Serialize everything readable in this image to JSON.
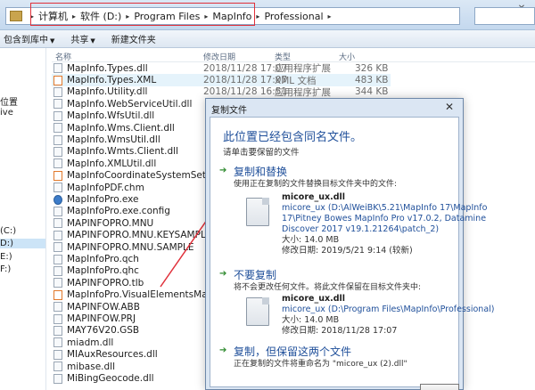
{
  "address_bar": {
    "crumbs": [
      "计算机",
      "软件 (D:)",
      "Program Files",
      "MapInfo",
      "Professional"
    ]
  },
  "window_controls": {
    "minimize": "—",
    "close": "✕"
  },
  "toolbar": {
    "items": [
      "包含到库中",
      "共享",
      "新建文件夹"
    ]
  },
  "nav": {
    "items": [
      "位置",
      "ive",
      "(C:)",
      "D:)",
      "E:)",
      "F:)"
    ]
  },
  "columns": {
    "name": "名称",
    "date": "修改日期",
    "type": "类型",
    "size": "大小"
  },
  "files": [
    {
      "name": "MapInfo.Types.dll",
      "date": "2018/11/28 17:07",
      "type": "应用程序扩展",
      "size": "326 KB",
      "icon": "dll"
    },
    {
      "name": "MapInfo.Types.XML",
      "date": "2018/11/28 17:07",
      "type": "XML 文档",
      "size": "483 KB",
      "icon": "xml"
    },
    {
      "name": "MapInfo.Utility.dll",
      "date": "2018/11/28 16:51",
      "type": "应用程序扩展",
      "size": "344 KB",
      "icon": "dll"
    },
    {
      "name": "MapInfo.WebServiceUtil.dll",
      "date": "",
      "type": "",
      "size": "",
      "icon": "dll"
    },
    {
      "name": "MapInfo.WfsUtil.dll",
      "date": "",
      "type": "",
      "size": "",
      "icon": "dll"
    },
    {
      "name": "MapInfo.Wms.Client.dll",
      "date": "",
      "type": "",
      "size": "",
      "icon": "dll"
    },
    {
      "name": "MapInfo.WmsUtil.dll",
      "date": "",
      "type": "",
      "size": "",
      "icon": "dll"
    },
    {
      "name": "MapInfo.Wmts.Client.dll",
      "date": "",
      "type": "",
      "size": "",
      "icon": "dll"
    },
    {
      "name": "MapInfo.XMLUtil.dll",
      "date": "",
      "type": "",
      "size": "",
      "icon": "dll"
    },
    {
      "name": "MapInfoCoordinateSystemSet.xml",
      "date": "",
      "type": "",
      "size": "",
      "icon": "xml"
    },
    {
      "name": "MapInfoPDF.chm",
      "date": "",
      "type": "",
      "size": "",
      "icon": "dll"
    },
    {
      "name": "MapInfoPro.exe",
      "date": "",
      "type": "",
      "size": "",
      "icon": "exe"
    },
    {
      "name": "MapInfoPro.exe.config",
      "date": "",
      "type": "",
      "size": "",
      "icon": "dll"
    },
    {
      "name": "MAPINFOPRO.MNU",
      "date": "",
      "type": "",
      "size": "",
      "icon": "dll"
    },
    {
      "name": "MAPINFOPRO.MNU.KEYSAMPLE",
      "date": "",
      "type": "",
      "size": "",
      "icon": "dll"
    },
    {
      "name": "MAPINFOPRO.MNU.SAMPLE",
      "date": "",
      "type": "",
      "size": "",
      "icon": "dll"
    },
    {
      "name": "MapInfoPro.qch",
      "date": "",
      "type": "",
      "size": "",
      "icon": "dll"
    },
    {
      "name": "MapInfoPro.qhc",
      "date": "",
      "type": "",
      "size": "",
      "icon": "dll"
    },
    {
      "name": "MAPINFOPRO.tlb",
      "date": "",
      "type": "",
      "size": "",
      "icon": "dll"
    },
    {
      "name": "MapInfoPro.VisualElementsManifest...",
      "date": "",
      "type": "",
      "size": "",
      "icon": "xml"
    },
    {
      "name": "MAPINFOW.ABB",
      "date": "",
      "type": "",
      "size": "",
      "icon": "dll"
    },
    {
      "name": "MAPINFOW.PRJ",
      "date": "",
      "type": "",
      "size": "",
      "icon": "dll"
    },
    {
      "name": "MAY76V20.GSB",
      "date": "",
      "type": "",
      "size": "",
      "icon": "dll"
    },
    {
      "name": "miadm.dll",
      "date": "",
      "type": "",
      "size": "",
      "icon": "dll"
    },
    {
      "name": "MIAuxResources.dll",
      "date": "",
      "type": "",
      "size": "",
      "icon": "dll"
    },
    {
      "name": "mibase.dll",
      "date": "",
      "type": "",
      "size": "",
      "icon": "dll"
    },
    {
      "name": "MiBingGeocode.dll",
      "date": "",
      "type": "",
      "size": "",
      "icon": "dll"
    }
  ],
  "dialog": {
    "title": "复制文件",
    "close": "✕",
    "heading": "此位置已经包含同名文件。",
    "subheading": "请单击要保留的文件",
    "option_replace": {
      "title": "复制和替换",
      "desc": "使用正在复制的文件替换目标文件夹中的文件:",
      "filename": "micore_ux.dll",
      "path_line1": "micore_ux (D:\\AlWeiBK\\5.21\\MapInfo 17\\MapInfo",
      "path_line2": "17\\Pitney Bowes MapInfo Pro v17.0.2, Datamine",
      "path_line3": "Discover 2017 v19.1.21264\\patch_2)",
      "size": "大小: 14.0 MB",
      "modified": "修改日期: 2019/5/21 9:14 (较新)"
    },
    "option_skip": {
      "title": "不要复制",
      "desc": "将不会更改任何文件。将此文件保留在目标文件夹中:",
      "filename": "micore_ux.dll",
      "path_line1": "micore_ux (D:\\Program Files\\MapInfo\\Professional)",
      "size": "大小: 14.0 MB",
      "modified": "修改日期: 2018/11/28 17:07"
    },
    "option_keep_both": {
      "title": "复制，但保留这两个文件",
      "desc": "正在复制的文件将重命名为 \"micore_ux (2).dll\""
    }
  }
}
